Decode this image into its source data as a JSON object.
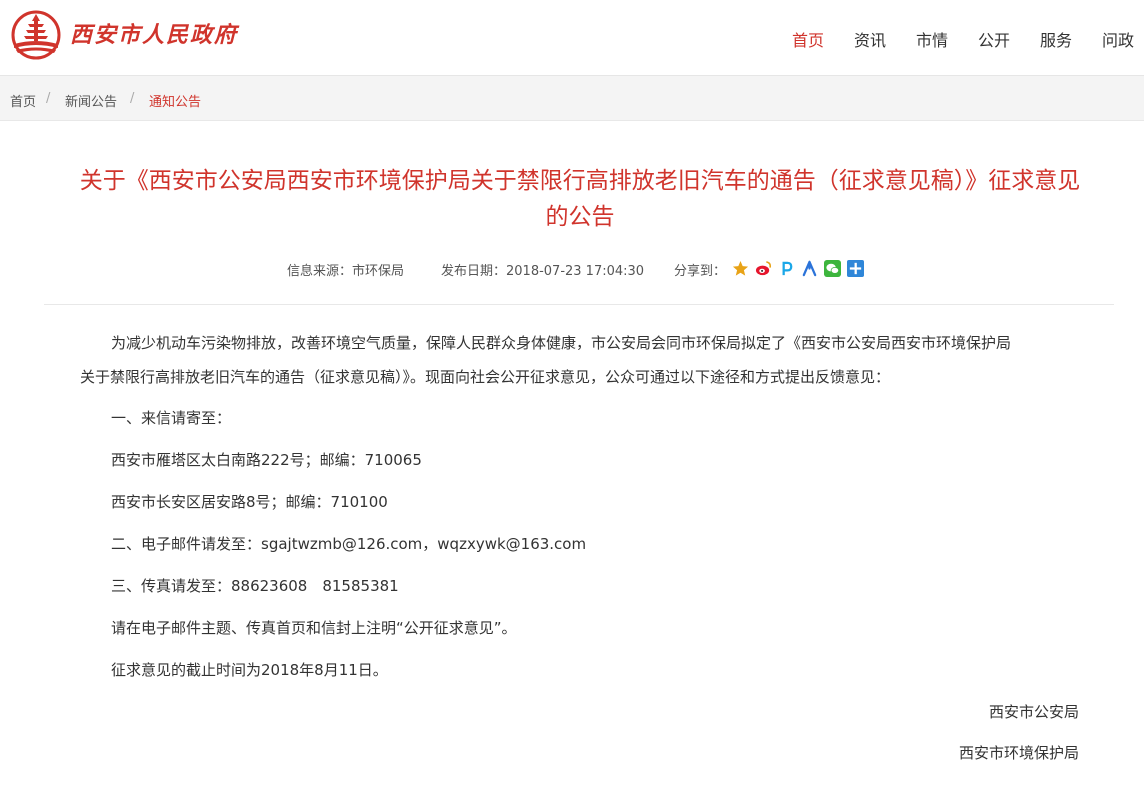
{
  "header": {
    "site_name": "西安市人民政府",
    "nav": [
      "首页",
      "资讯",
      "市情",
      "公开",
      "服务",
      "问政"
    ],
    "active_nav": 0
  },
  "breadcrumb": {
    "items": [
      "首页",
      "新闻公告",
      "通知公告"
    ],
    "separator": "/"
  },
  "article": {
    "title_line1": "关于《西安市公安局西安市环境保护局关于禁限行高排放老旧汽车的通告（征求意见稿）》征求意见",
    "title_line2": "的公告",
    "source_label": "信息来源：市环保局",
    "date_label": "发布日期：2018-07-23 17:04:30",
    "share_label": "分享到：",
    "paragraphs": [
      "为减少机动车污染物排放，改善环境空气质量，保障人民群众身体健康，市公安局会同市环保局拟定了《西安市公安局西安市环境保护局",
      "关于禁限行高排放老旧汽车的通告（征求意见稿）》。现面向社会公开征求意见，公众可通过以下途径和方式提出反馈意见：",
      "一、来信请寄至：",
      "西安市雁塔区太白南路222号；邮编：710065",
      "西安市长安区居安路8号；邮编：710100",
      "二、电子邮件请发至：sgajtwzmb@126.com，wqzxywk@163.com",
      "三、传真请发至：88623608　81585381",
      "请在电子邮件主题、传真首页和信封上注明“公开征求意见”。",
      "征求意见的截止时间为2018年8月11日。"
    ],
    "signatures": [
      "西安市公安局",
      "西安市环境保护局"
    ]
  },
  "colors": {
    "accent": "#d0342c",
    "share_colors": [
      "#e8a317",
      "#e6162d",
      "#1aa7e8",
      "#2b73d9",
      "#3db53d",
      "#2f86d8"
    ]
  },
  "share_icons": [
    "qzone-star-icon",
    "weibo-icon",
    "pengyou-icon",
    "renren-icon",
    "wechat-icon",
    "more-plus-icon"
  ]
}
